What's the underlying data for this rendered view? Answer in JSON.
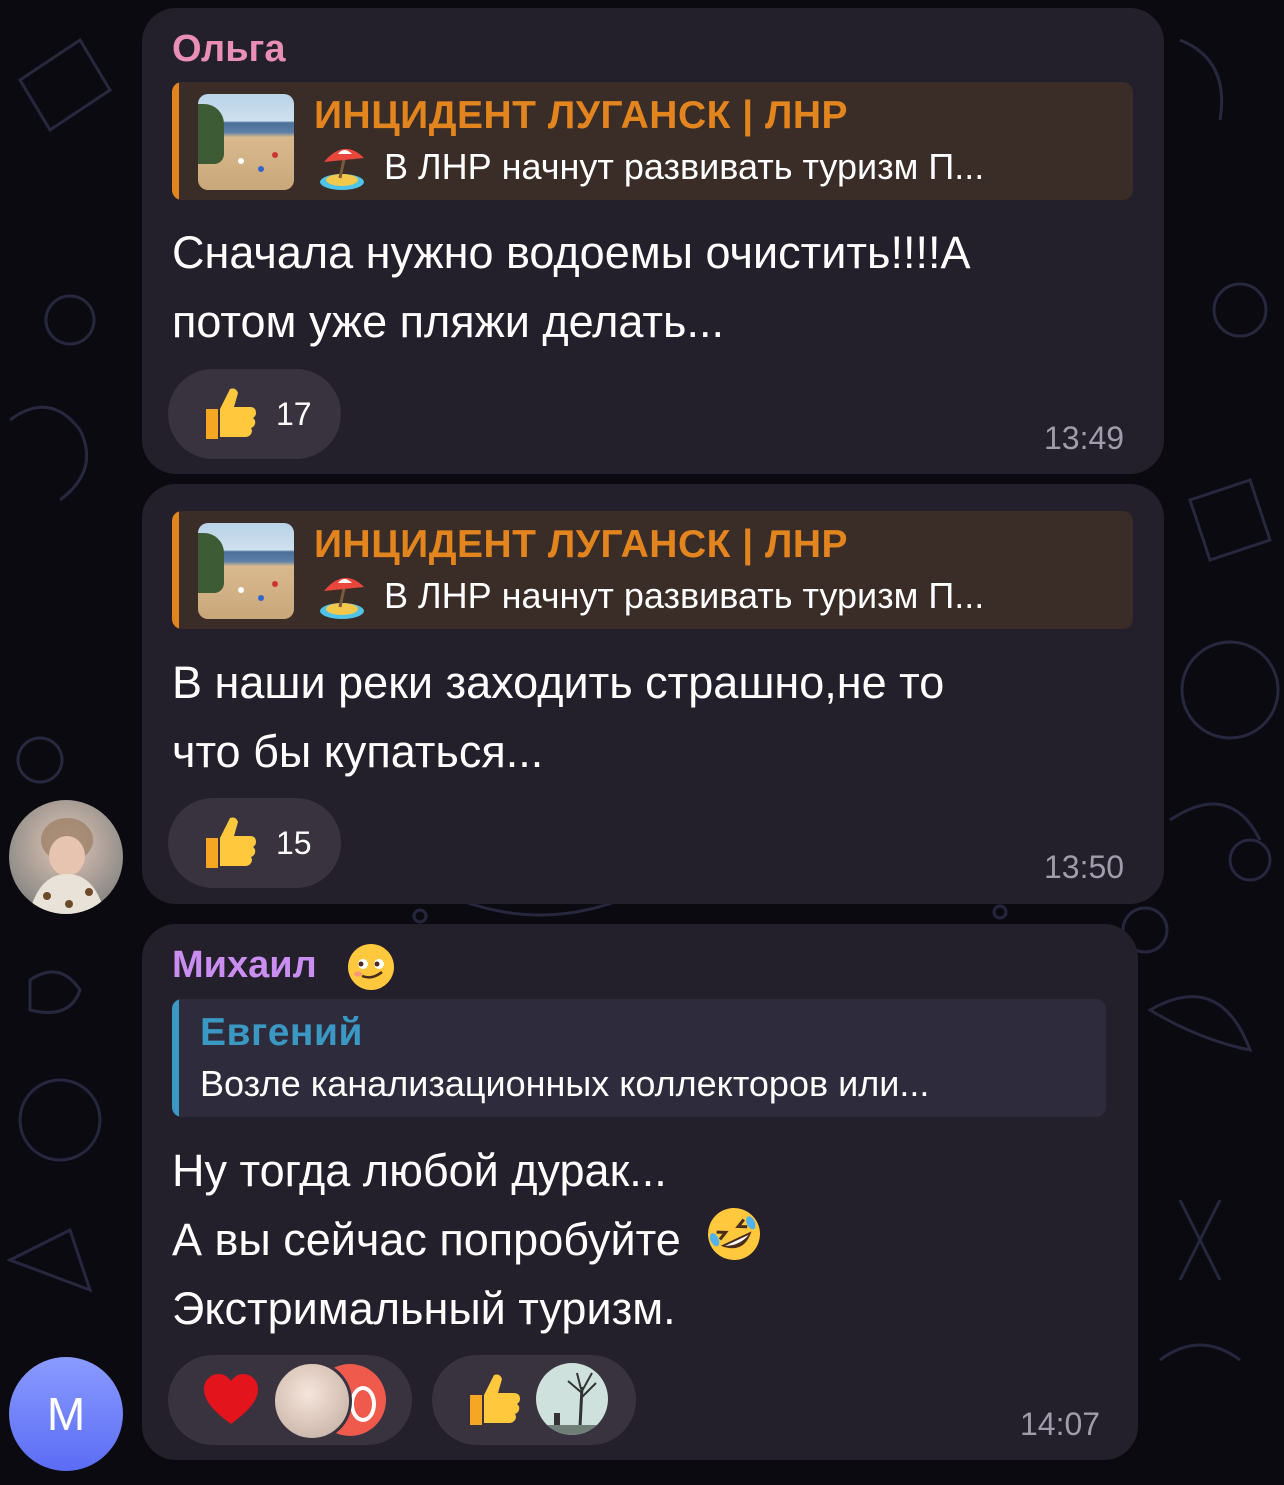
{
  "messages": [
    {
      "sender": "Ольга",
      "reply": {
        "title": "ИНЦИДЕНТ ЛУГАНСК | ЛНР",
        "preview_icon": "beach-umbrella-emoji",
        "text": "В ЛНР начнут развивать туризм П..."
      },
      "text_lines": [
        "Сначала нужно водоемы очистить!!!!А",
        "потом уже пляжи делать..."
      ],
      "reaction": {
        "icon": "thumbs-up-emoji",
        "count": "17"
      },
      "time": "13:49"
    },
    {
      "reply": {
        "title": "ИНЦИДЕНТ ЛУГАНСК | ЛНР",
        "preview_icon": "beach-umbrella-emoji",
        "text": "В ЛНР начнут развивать туризм П..."
      },
      "text_lines": [
        "В наши реки заходить страшно,не то",
        "что бы купаться..."
      ],
      "reaction": {
        "icon": "thumbs-up-emoji",
        "count": "15"
      },
      "time": "13:50"
    },
    {
      "sender": "Михаил",
      "sender_icon": "smirk-face-emoji",
      "reply": {
        "title": "Евгений",
        "text": "Возле канализационных коллекторов или..."
      },
      "text_lines": [
        "Ну тогда любой дурак...",
        "А вы сейчас попробуйте",
        "Экстримальный туризм."
      ],
      "inline_icon": "rofl-emoji",
      "reactions": [
        {
          "icon": "red-heart-emoji",
          "reactors": [
            "blurred-avatar",
            "red-avatar"
          ]
        },
        {
          "icon": "thumbs-up-emoji",
          "reactors": [
            "tree-avatar"
          ]
        }
      ],
      "time": "14:07"
    }
  ],
  "avatars": {
    "m_letter": "М"
  },
  "colors": {
    "olga_name": "#e98fb6",
    "mikhail_name": "#c98ef0",
    "channel_orange": "#e3851f",
    "reply_blue": "#3a98c2",
    "bubble": "#231f2b",
    "time": "#a09cab"
  }
}
